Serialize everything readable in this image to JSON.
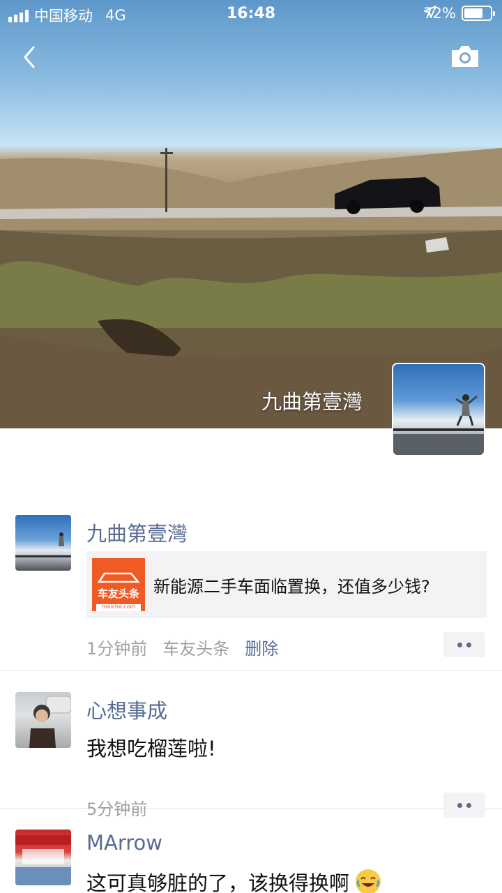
{
  "status_bar": {
    "carrier": "中国移动",
    "network": "4G",
    "time": "16:48",
    "battery": "72%",
    "battery_level": 0.72
  },
  "header": {
    "back_icon": "chevron-left-icon",
    "camera_icon": "camera-icon"
  },
  "profile": {
    "cover_name": "九曲第壹灣"
  },
  "posts": [
    {
      "name": "九曲第壹灣",
      "share": {
        "thumb_text": "车友头条",
        "thumb_sub": "maiche.com",
        "title": "新能源二手车面临置换，还值多少钱?"
      },
      "time": "1分钟前",
      "source": "车友头条",
      "delete_label": "删除"
    },
    {
      "name": "心想事成",
      "text": "我想吃榴莲啦!",
      "time": "5分钟前"
    },
    {
      "name": "MArrow",
      "text": "这可真够脏的了，该换得换啊"
    }
  ],
  "colors": {
    "link": "#576b95",
    "meta": "#a0a0a0",
    "card_bg": "#f3f3f5",
    "brand_orange": "#f05a24"
  }
}
